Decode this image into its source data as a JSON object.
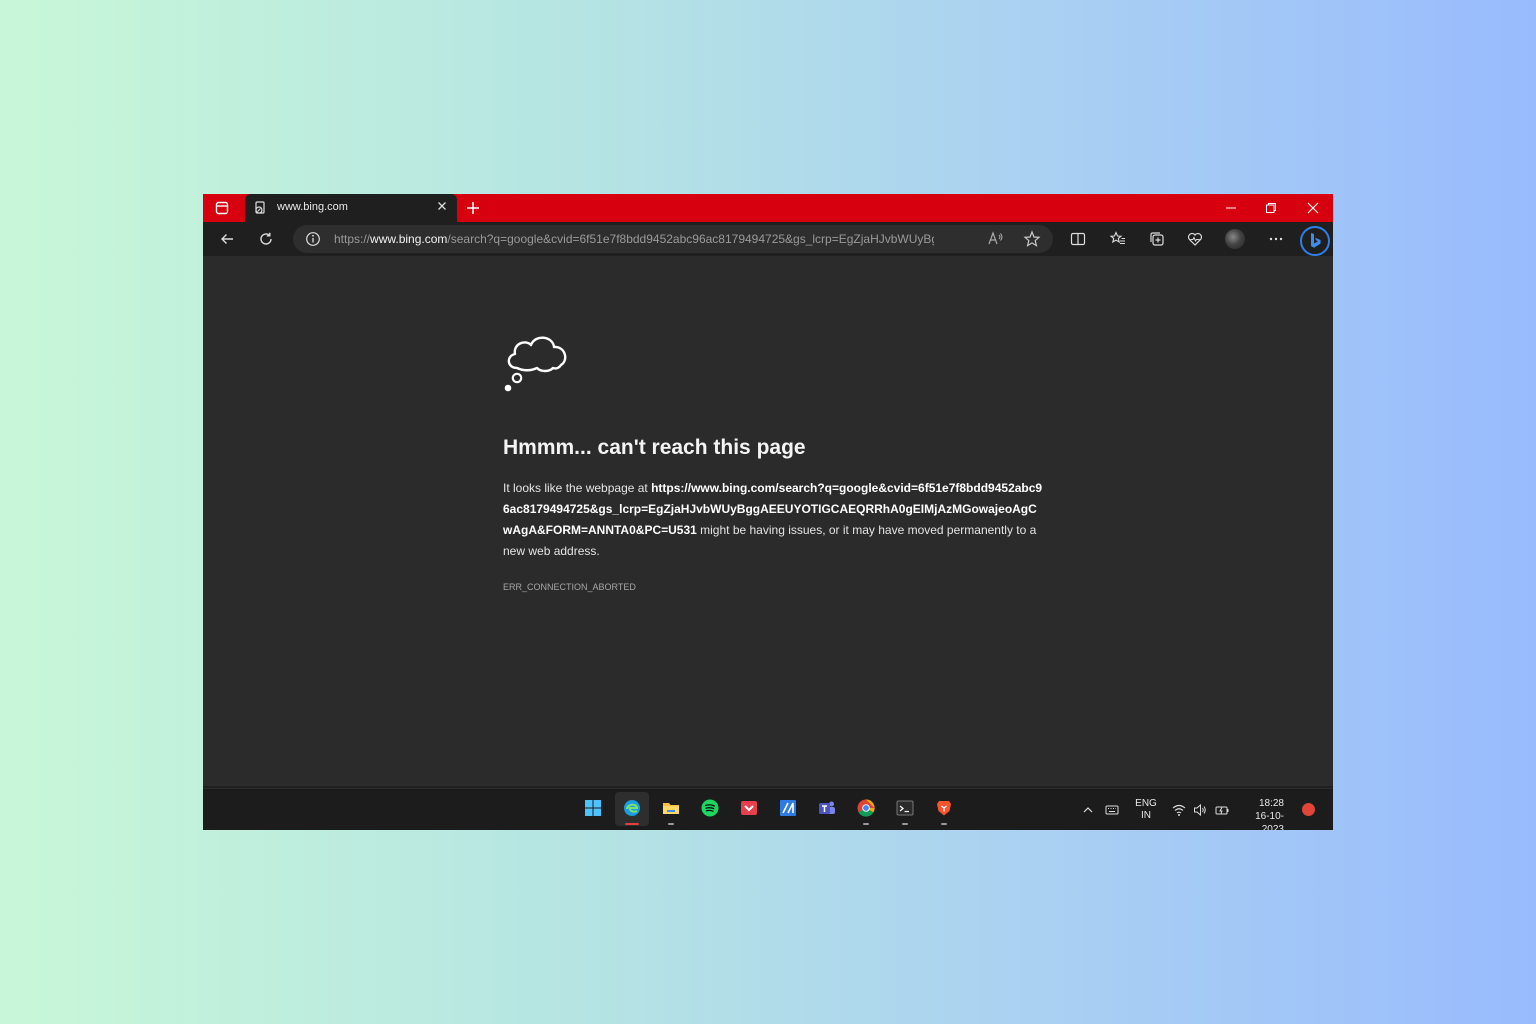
{
  "tab": {
    "title": "www.bing.com"
  },
  "address": {
    "scheme": "https://",
    "host": "www.bing.com",
    "path": "/search?q=google&cvid=6f51e7f8bdd9452abc96ac8179494725&gs_lcrp=EgZjaHJvbWUyBgg..."
  },
  "error": {
    "heading": "Hmmm... can't reach this page",
    "intro": "It looks like the webpage at ",
    "url": "https://www.bing.com/search?q=google&cvid=6f51e7f8bdd9452abc96ac8179494725&gs_lcrp=EgZjaHJvbWUyBggAEEUYOTIGCAEQRRhA0gEIMjAzMGowajeoAgCwAgA&FORM=ANNTA0&PC=U531",
    "outro": " might be having issues, or it may have moved permanently to a new web address.",
    "code": "ERR_CONNECTION_ABORTED"
  },
  "taskbar": {
    "apps": [
      "start-icon",
      "edge-icon",
      "file-explorer-icon",
      "spotify-icon",
      "pocket-icon",
      "visual-studio-icon",
      "teams-icon",
      "chrome-icon",
      "terminal-icon",
      "brave-icon"
    ],
    "language": "ENG",
    "region": "IN",
    "time": "18:28",
    "date": "16-10-2023"
  },
  "colors": {
    "titlebar": "#d6000f",
    "page_bg": "#2b2b2b",
    "accent": "#2f7fe6"
  }
}
